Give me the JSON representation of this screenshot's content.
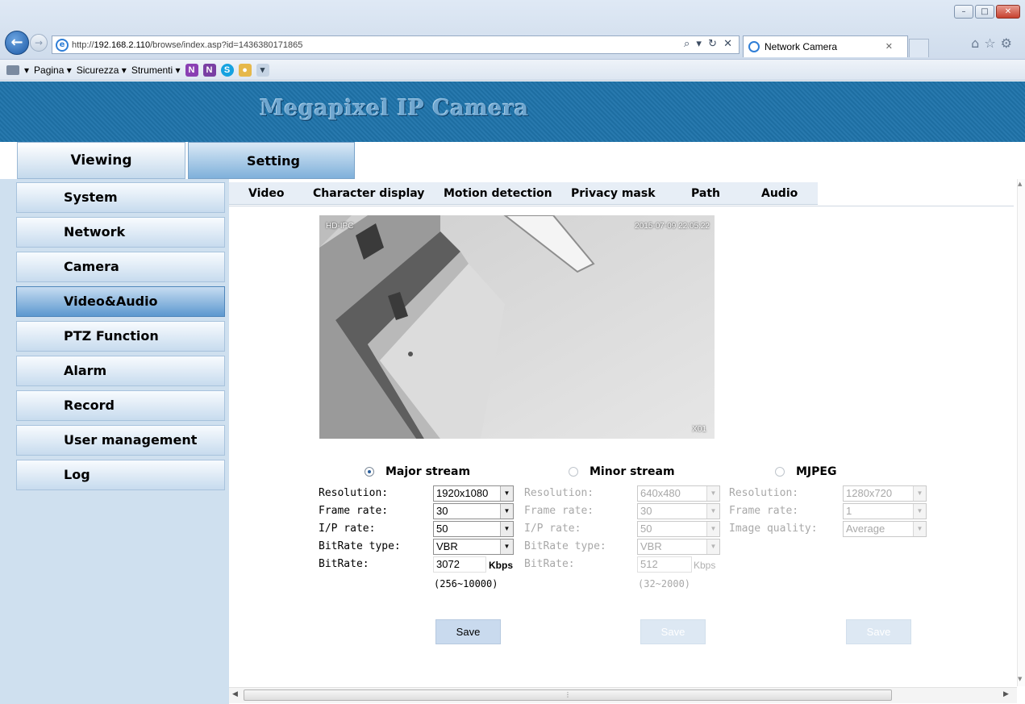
{
  "browser": {
    "url_prefix": "http://",
    "url_domain": "192.168.2.110",
    "url_path": "/browse/index.asp?id=1436380171865",
    "tab_title": "Network Camera",
    "address_tools": "⌕ ▾ ↻ ✕",
    "command_bar": [
      "Pagina ▾",
      "Sicurezza ▾",
      "Strumenti ▾"
    ]
  },
  "banner": {
    "title": "Megapixel IP Camera"
  },
  "top_tabs": {
    "viewing": "Viewing",
    "setting": "Setting"
  },
  "sidebar": {
    "items": [
      {
        "label": "System"
      },
      {
        "label": "Network"
      },
      {
        "label": "Camera"
      },
      {
        "label": "Video&Audio",
        "active": true
      },
      {
        "label": "PTZ Function"
      },
      {
        "label": "Alarm"
      },
      {
        "label": "Record"
      },
      {
        "label": "User management"
      },
      {
        "label": "Log"
      }
    ]
  },
  "sub_tabs": [
    "Video",
    "Character display",
    "Motion detection",
    "Privacy mask",
    "Path",
    "Audio"
  ],
  "video": {
    "osd_name": "HD-IPC",
    "osd_time": "2015-07-09  22:05:22",
    "osd_channel": "X01"
  },
  "streams": {
    "major": {
      "title": "Major stream",
      "selected": true,
      "resolution_label": "Resolution:",
      "resolution": "1920x1080",
      "framerate_label": "Frame rate:",
      "framerate": "30",
      "iprate_label": "I/P rate:",
      "iprate": "50",
      "bitrate_type_label": "BitRate type:",
      "bitrate_type": "VBR",
      "bitrate_label": "BitRate:",
      "bitrate": "3072",
      "unit": "Kbps",
      "range": "(256~10000)",
      "save": "Save"
    },
    "minor": {
      "title": "Minor stream",
      "selected": false,
      "resolution_label": "Resolution:",
      "resolution": "640x480",
      "framerate_label": "Frame rate:",
      "framerate": "30",
      "iprate_label": "I/P rate:",
      "iprate": "50",
      "bitrate_type_label": "BitRate type:",
      "bitrate_type": "VBR",
      "bitrate_label": "BitRate:",
      "bitrate": "512",
      "unit": "Kbps",
      "range": "(32~2000)",
      "save": "Save"
    },
    "mjpeg": {
      "title": "MJPEG",
      "selected": false,
      "resolution_label": "Resolution:",
      "resolution": "1280x720",
      "framerate_label": "Frame rate:",
      "framerate": "1",
      "quality_label": "Image quality:",
      "quality": "Average",
      "save": "Save"
    }
  },
  "colors": {
    "banner": "#1f74ab",
    "sidebar_bg": "#cfe0ef",
    "active_item": "#5c98cf",
    "save_button": "#c9daee"
  }
}
